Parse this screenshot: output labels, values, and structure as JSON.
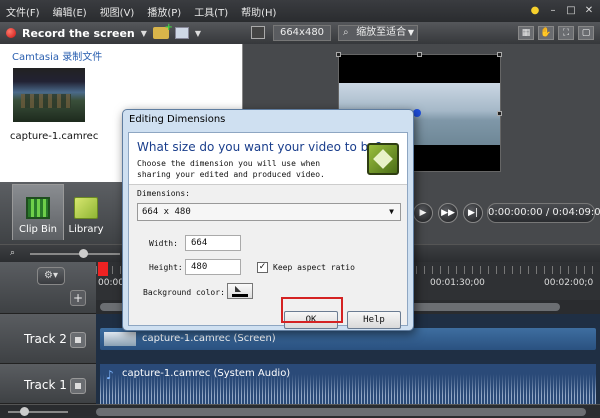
{
  "menu": [
    "文件(F)",
    "编辑(E)",
    "视图(V)",
    "播放(P)",
    "工具(T)",
    "帮助(H)"
  ],
  "left_toolbar": {
    "record_label": "Record the screen"
  },
  "clip_bin": {
    "title": "Camtasia 录制文件",
    "clip_name": "capture-1.camrec"
  },
  "tabs": [
    {
      "label": "Clip Bin"
    },
    {
      "label": "Library"
    }
  ],
  "preview": {
    "dimension": "664x480",
    "zoom": "缩放至适合",
    "timecode": "0:00:00:00 / 0:04:09:05"
  },
  "timeline": {
    "ruler_labels": [
      "00:00:",
      "00:01:30;00",
      "00:02:00;0"
    ],
    "tracks": [
      {
        "label": "Track 2",
        "clip": "capture-1.camrec (Screen)"
      },
      {
        "label": "Track 1",
        "clip": "capture-1.camrec (System Audio)"
      }
    ]
  },
  "dialog": {
    "title": "Editing Dimensions",
    "question": "What size do you want your video to be?",
    "description": "Choose the dimension you will use when sharing your edited and produced video.",
    "dimensions_label": "Dimensions:",
    "dimensions_value": "664 x 480",
    "width_label": "Width:",
    "width_value": "664",
    "height_label": "Height:",
    "height_value": "480",
    "keep_aspect_label": "Keep aspect ratio",
    "keep_aspect_checked": true,
    "background_label": "Background color:",
    "background_color": "#000000",
    "ok_label": "OK",
    "help_label": "Help"
  }
}
